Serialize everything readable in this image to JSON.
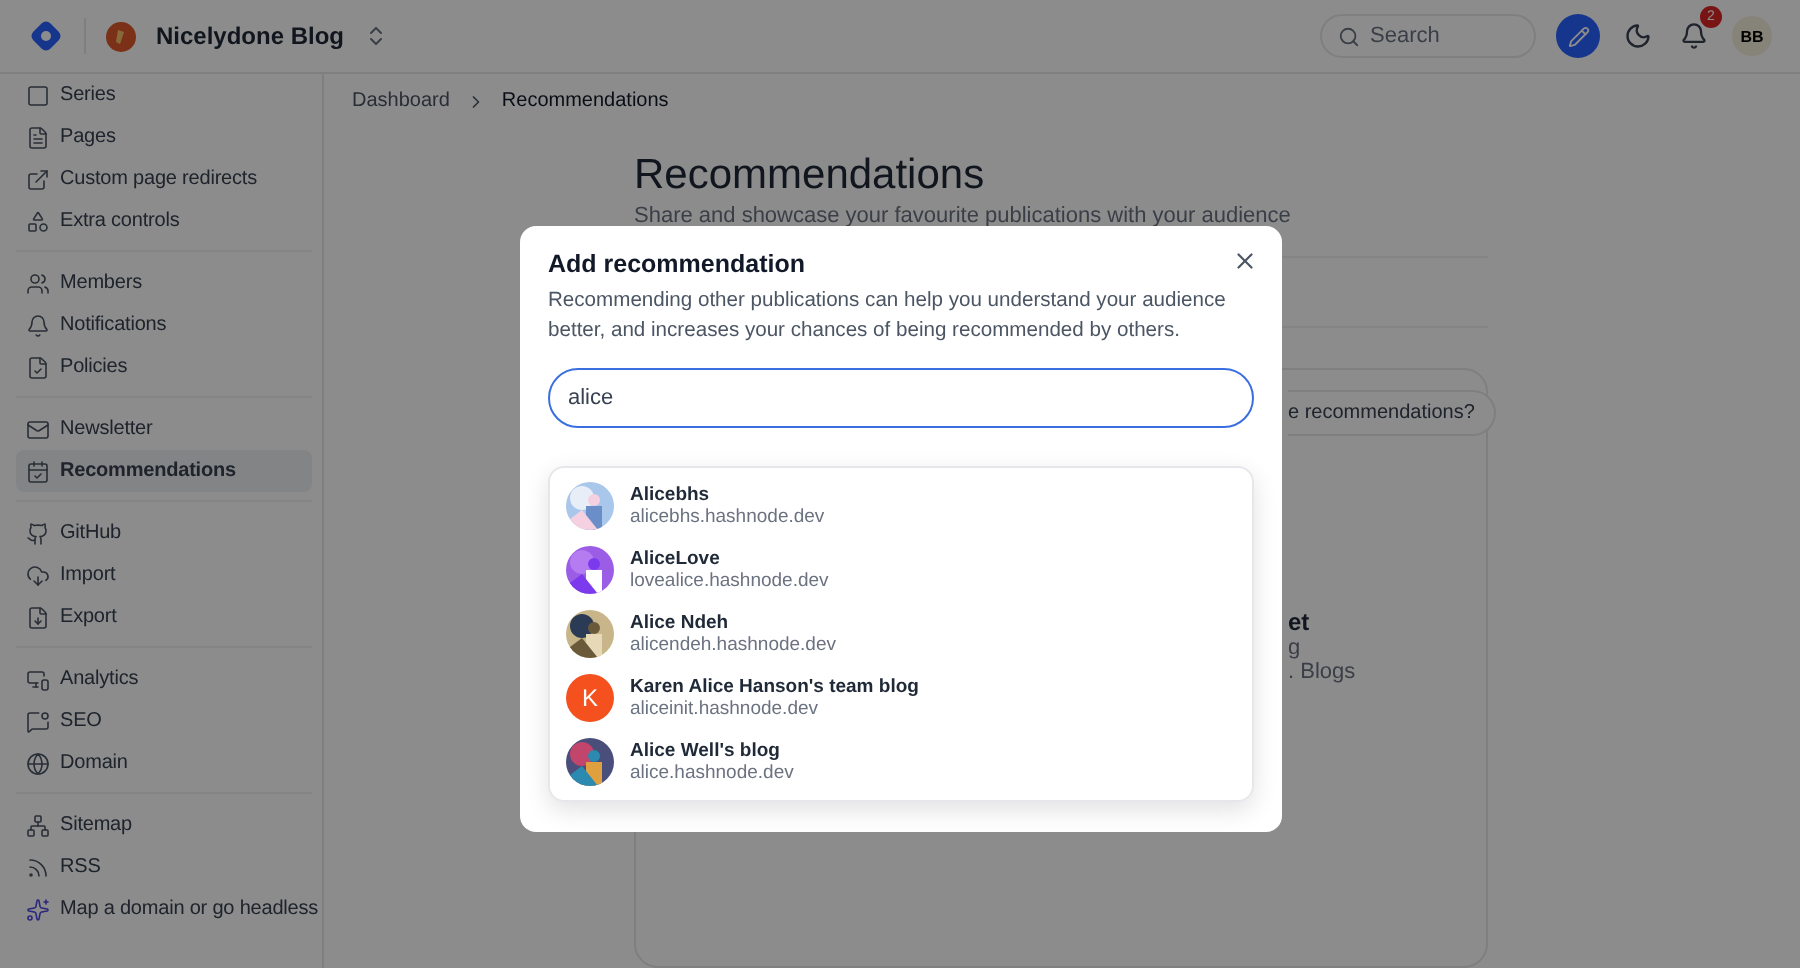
{
  "header": {
    "blog_name": "Nicelydone Blog",
    "search": {
      "placeholder": "Search"
    },
    "notification_count": "2",
    "user_initials": "BB"
  },
  "sidebar": {
    "groups": [
      {
        "items": [
          {
            "label": "Series",
            "selected": false
          },
          {
            "label": "Pages",
            "selected": false
          },
          {
            "label": "Custom page redirects",
            "selected": false
          },
          {
            "label": "Extra controls",
            "selected": false
          }
        ]
      },
      {
        "items": [
          {
            "label": "Members",
            "selected": false
          },
          {
            "label": "Notifications",
            "selected": false
          },
          {
            "label": "Policies",
            "selected": false
          }
        ]
      },
      {
        "items": [
          {
            "label": "Newsletter",
            "selected": false
          },
          {
            "label": "Recommendations",
            "selected": true
          }
        ]
      },
      {
        "items": [
          {
            "label": "GitHub",
            "selected": false
          },
          {
            "label": "Import",
            "selected": false
          },
          {
            "label": "Export",
            "selected": false
          }
        ]
      },
      {
        "items": [
          {
            "label": "Analytics",
            "selected": false
          },
          {
            "label": "SEO",
            "selected": false
          },
          {
            "label": "Domain",
            "selected": false
          }
        ]
      },
      {
        "items": [
          {
            "label": "Sitemap",
            "selected": false
          },
          {
            "label": "RSS",
            "selected": false
          },
          {
            "label": "Map a domain or go headless",
            "selected": false
          }
        ]
      }
    ]
  },
  "breadcrumb": [
    "Dashboard",
    "Recommendations"
  ],
  "page": {
    "title": "Recommendations",
    "subtitle": "Share and showcase your favourite publications with your audience",
    "button_fragment": "e recommendations?",
    "empty_title_fragment": "et",
    "empty_text_fragments": [
      "g",
      ". Blogs"
    ]
  },
  "modal": {
    "title": "Add recommendation",
    "description": "Recommending other publications can help you understand your audience better, and increases your chances of being recommended by others.",
    "search_value": "alice",
    "results": [
      {
        "name": "Alicebhs",
        "url": "alicebhs.hashnode.dev"
      },
      {
        "name": "AliceLove",
        "url": "lovealice.hashnode.dev"
      },
      {
        "name": "Alice Ndeh",
        "url": "alicendeh.hashnode.dev"
      },
      {
        "name": "Karen Alice Hanson's team blog",
        "url": "aliceinit.hashnode.dev",
        "avatar": {
          "kind": "letter",
          "letter": "K",
          "color": "#f4511e"
        }
      },
      {
        "name": "Alice Well's blog",
        "url": "alice.hashnode.dev"
      }
    ]
  }
}
